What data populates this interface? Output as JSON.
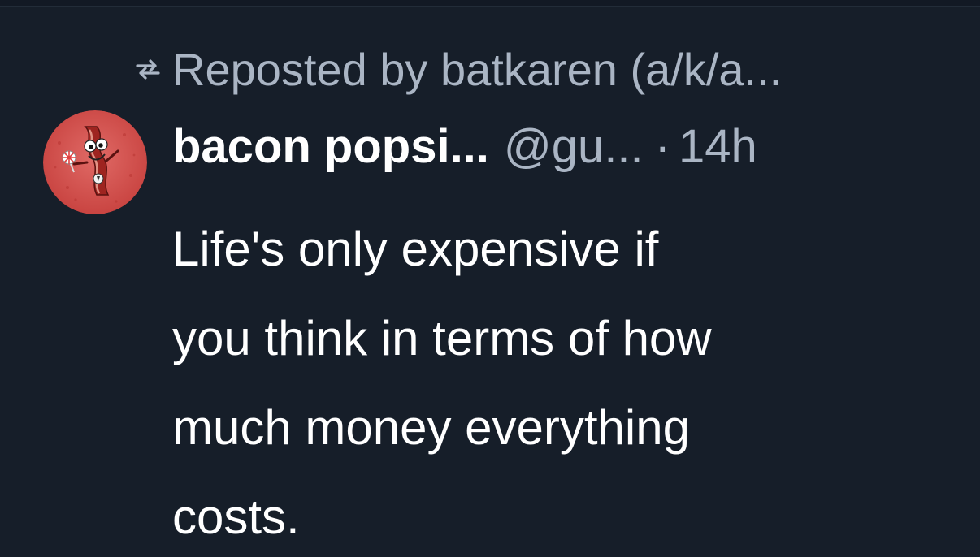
{
  "repost": {
    "icon": "repost-icon",
    "text": "Reposted by batkaren (a/k/a..."
  },
  "author": {
    "avatar": "bacon-mascot-avatar",
    "display_name": "bacon popsi...",
    "handle": "@gu...",
    "separator": "·",
    "timestamp": "14h"
  },
  "post": {
    "lines": [
      "Life's only expensive if",
      "you think in terms of how",
      "much money everything",
      "costs."
    ]
  },
  "colors": {
    "background": "#161e29",
    "primary_text": "#ffffff",
    "secondary_text": "#aab5c4",
    "avatar_bg": "#d04a4a"
  }
}
